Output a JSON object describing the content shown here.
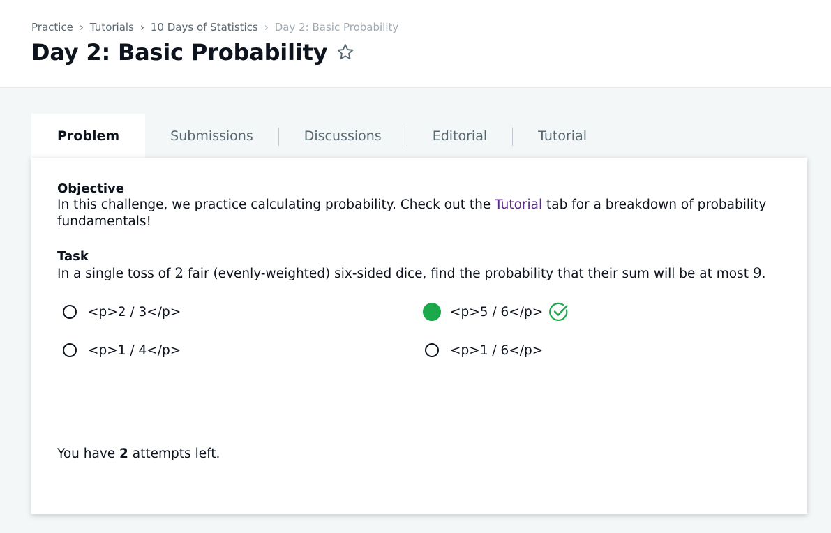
{
  "breadcrumb": {
    "items": [
      "Practice",
      "Tutorials",
      "10 Days of Statistics",
      "Day 2: Basic Probability"
    ]
  },
  "page": {
    "title": "Day 2: Basic Probability",
    "star_icon": "star-outline-icon"
  },
  "tabs": [
    {
      "label": "Problem",
      "active": true
    },
    {
      "label": "Submissions",
      "active": false
    },
    {
      "label": "Discussions",
      "active": false
    },
    {
      "label": "Editorial",
      "active": false
    },
    {
      "label": "Tutorial",
      "active": false
    }
  ],
  "problem": {
    "objective_heading": "Objective",
    "objective_before": "In this challenge, we practice calculating probability. Check out the ",
    "objective_link": "Tutorial",
    "objective_after": " tab for a breakdown of probability fundamentals!",
    "task_heading": "Task",
    "task_part1": "In a single toss of ",
    "task_num1": "2",
    "task_part2": " fair (evenly-weighted) six-sided dice, find the probability that their sum will be at most ",
    "task_num2": "9",
    "task_part3": ".",
    "options": [
      {
        "label": "<p>2 / 3</p>",
        "selected": false
      },
      {
        "label": "<p>5 / 6</p>",
        "selected": true,
        "correct": true
      },
      {
        "label": "<p>1 / 4</p>",
        "selected": false
      },
      {
        "label": "<p>1 / 6</p>",
        "selected": false
      }
    ],
    "attempts_before": "You have ",
    "attempts_count": "2",
    "attempts_after": " attempts left."
  },
  "colors": {
    "accent_green": "#1ba94c",
    "link_purple": "#5b2a86"
  }
}
